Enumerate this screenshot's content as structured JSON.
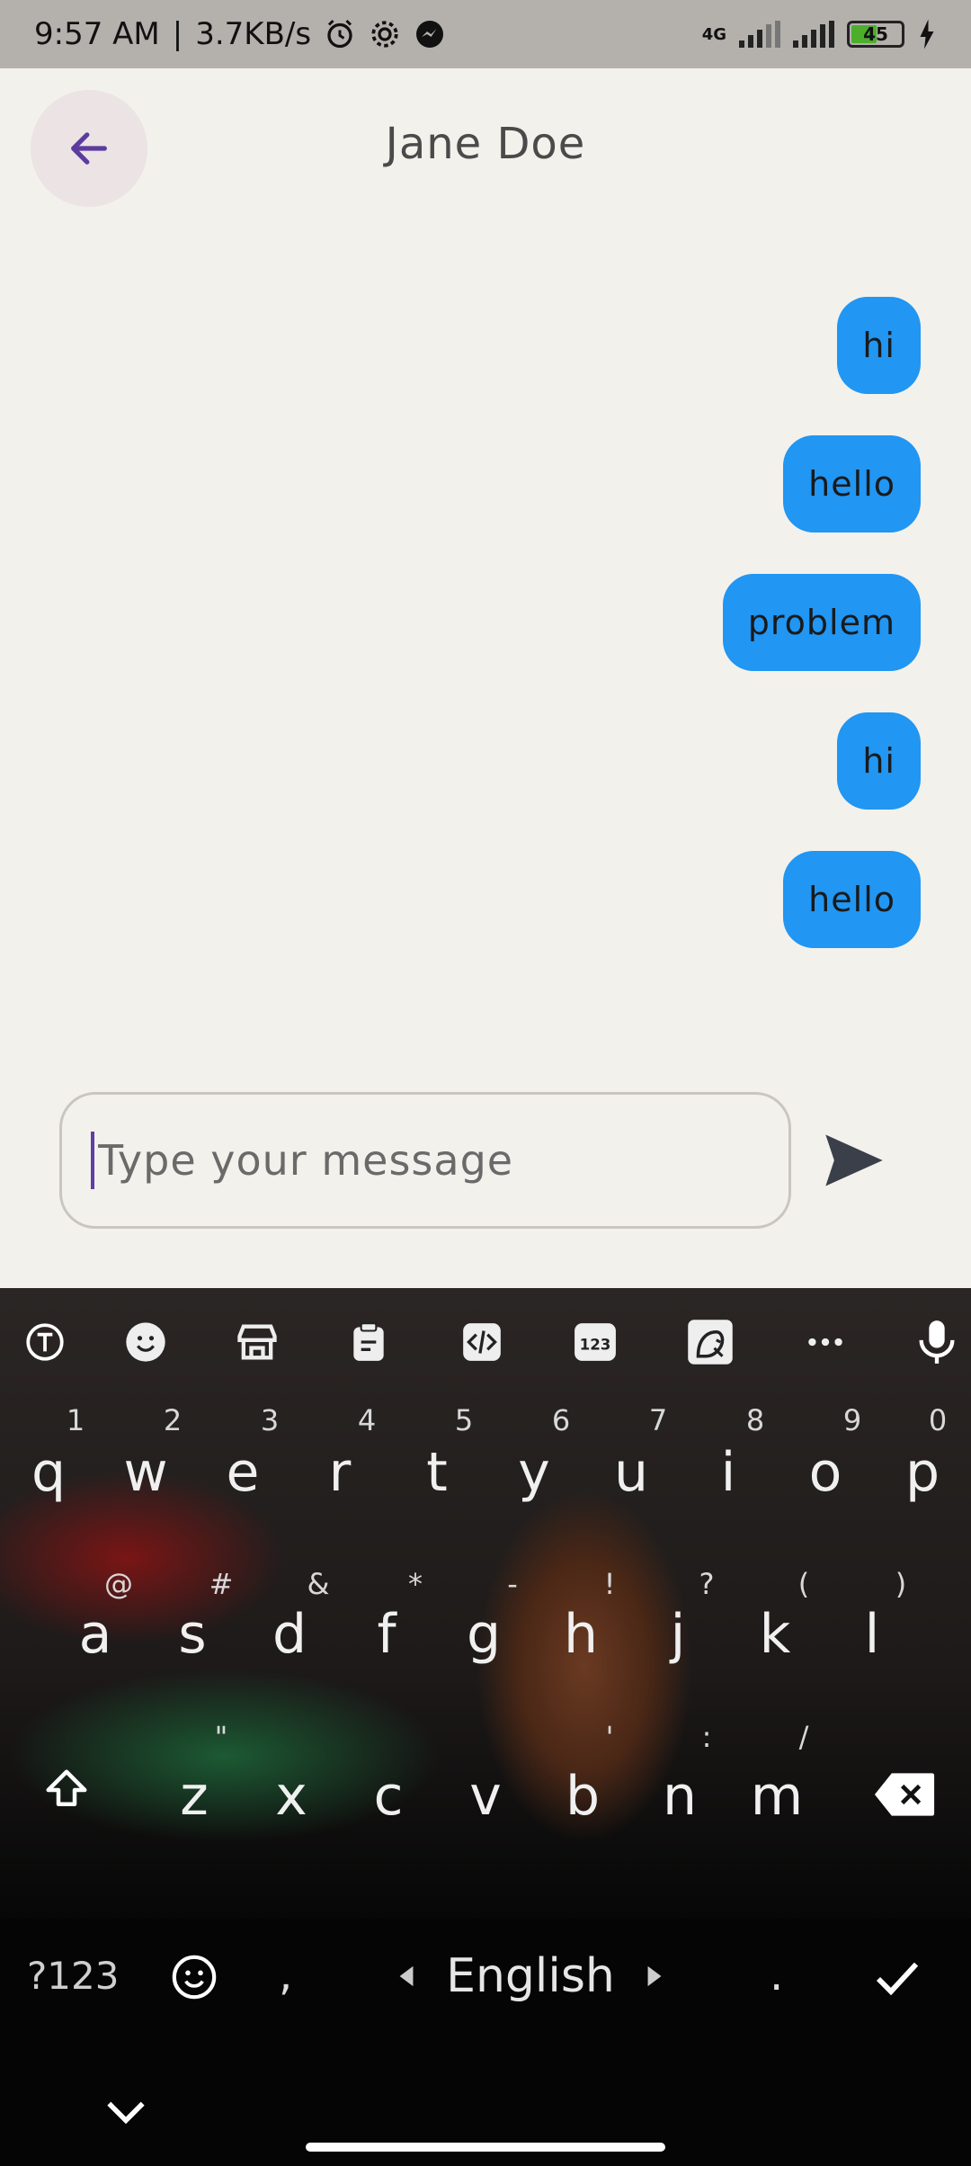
{
  "status_bar": {
    "time": "9:57 AM",
    "speed": "3.7KB/s",
    "network": "4G",
    "battery": "45"
  },
  "header": {
    "title": "Jane Doe"
  },
  "messages": [
    {
      "text": "hi"
    },
    {
      "text": "hello"
    },
    {
      "text": "problem"
    },
    {
      "text": "hi"
    },
    {
      "text": "hello"
    }
  ],
  "composer": {
    "placeholder": "Type your message"
  },
  "keyboard": {
    "row1": [
      "q",
      "w",
      "e",
      "r",
      "t",
      "y",
      "u",
      "i",
      "o",
      "p"
    ],
    "row1_hints": [
      "1",
      "2",
      "3",
      "4",
      "5",
      "6",
      "7",
      "8",
      "9",
      "0"
    ],
    "row2": [
      "a",
      "s",
      "d",
      "f",
      "g",
      "h",
      "j",
      "k",
      "l"
    ],
    "row2_hints": [
      "@",
      "#",
      "&",
      "*",
      "-",
      "!",
      "?",
      "(",
      ")"
    ],
    "row3": [
      "z",
      "x",
      "c",
      "v",
      "b",
      "n",
      "m"
    ],
    "row3_hints": [
      "\"",
      "'",
      ":",
      "/"
    ],
    "symbols_key": "?123",
    "comma": ",",
    "language": "English",
    "period": ".",
    "toolbar_icons": [
      "text-icon",
      "emoji-icon",
      "store-icon",
      "clipboard-icon",
      "code-icon",
      "numpad-icon",
      "bird-icon",
      "more-icon",
      "mic-icon"
    ]
  }
}
